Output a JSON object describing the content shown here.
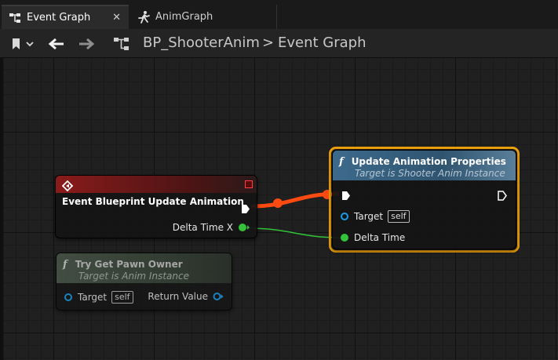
{
  "tabs": [
    {
      "label": "Event Graph",
      "active": true
    },
    {
      "label": "AnimGraph",
      "active": false
    }
  ],
  "breadcrumb": {
    "blueprint": "BP_ShooterAnim",
    "separator": ">",
    "graph": "Event Graph"
  },
  "nodes": {
    "event": {
      "title": "Event Blueprint Update Animation",
      "output_pin": "Delta Time X",
      "header_color": "#8a1b1b"
    },
    "pawn_owner": {
      "title": "Try Get Pawn Owner",
      "subtitle": "Target is Anim Instance",
      "target_label": "Target",
      "target_value": "self",
      "return_label": "Return Value"
    },
    "update_props": {
      "title": "Update Animation Properties",
      "subtitle": "Target is Shooter Anim Instance",
      "target_label": "Target",
      "target_value": "self",
      "delta_label": "Delta Time",
      "selected": true
    }
  },
  "colors": {
    "exec_wire": "#ff4a12",
    "float_wire": "#33c23a",
    "selection": "#f0a30a",
    "object_pin": "#1a9ce8"
  },
  "icons": {
    "tab_event_graph": "graph-icon",
    "tab_anim_graph": "running-figure-icon",
    "tab_close": "close-icon",
    "toolbar_bookmark": "bookmark-icon",
    "toolbar_back": "arrow-left-icon",
    "toolbar_forward": "arrow-right-icon",
    "breadcrumb_graph": "graph-icon"
  }
}
